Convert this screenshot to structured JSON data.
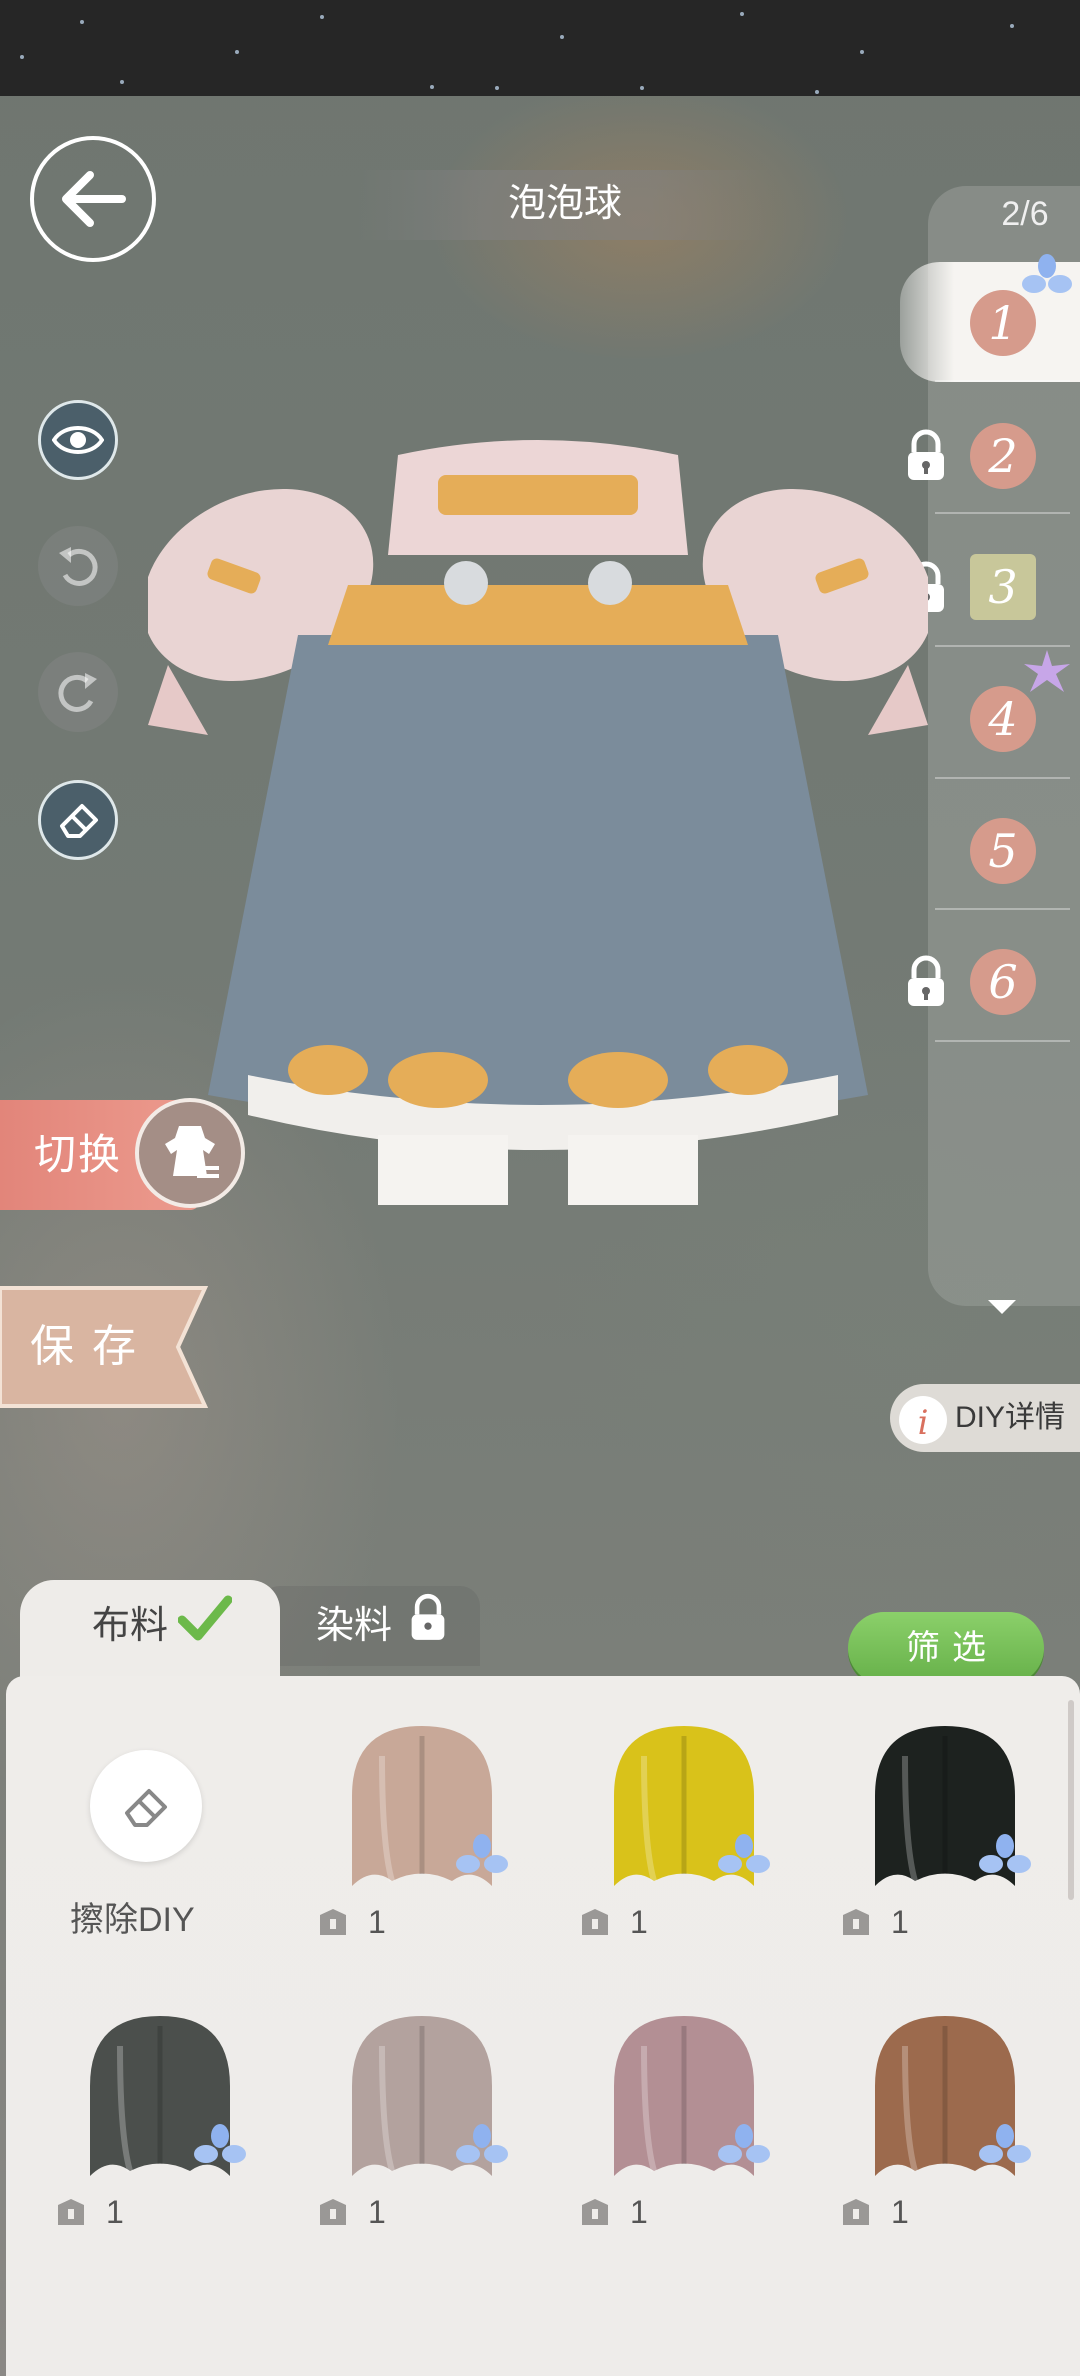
{
  "header": {
    "title": "泡泡球"
  },
  "slots": {
    "counter": "2/6",
    "items": [
      {
        "num": "1",
        "locked": false
      },
      {
        "num": "2",
        "locked": true
      },
      {
        "num": "3",
        "locked": true
      },
      {
        "num": "4",
        "locked": false
      },
      {
        "num": "5",
        "locked": false
      },
      {
        "num": "6",
        "locked": true
      }
    ]
  },
  "actions": {
    "switch_label": "切换",
    "save_label": "保存",
    "diy_detail_label": "DIY详情"
  },
  "tabs": {
    "fabric": "布料",
    "dye": "染料",
    "filter": "筛选"
  },
  "materials": {
    "erase_label": "擦除DIY",
    "items": [
      {
        "color": "#c8a898",
        "qty": "1"
      },
      {
        "color": "#d9c21a",
        "qty": "1"
      },
      {
        "color": "#1d221f",
        "qty": "1"
      },
      {
        "color": "#4b4f4c",
        "qty": "1"
      },
      {
        "color": "#b3a29e",
        "qty": "1"
      },
      {
        "color": "#b38f94",
        "qty": "1"
      },
      {
        "color": "#9c6a4d",
        "qty": "1"
      }
    ]
  },
  "colors": {
    "accent": "#ec9b8e",
    "filter": "#77c158",
    "slot_number": "#d69b8c"
  }
}
